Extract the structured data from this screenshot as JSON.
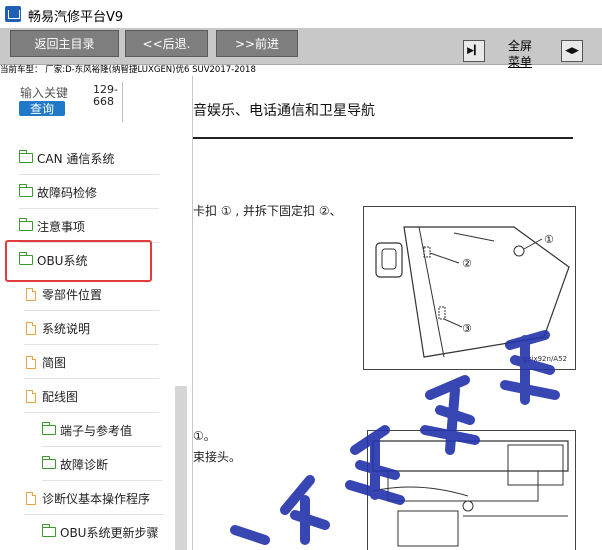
{
  "window": {
    "title": "畅易汽修平台V9"
  },
  "toolbar": {
    "home_label": "返回主目录",
    "back_label": "<<后退.",
    "forward_label": ">>前进",
    "fullscreen_top": "全屏",
    "fullscreen_bottom": "菜单"
  },
  "vehicle": {
    "text": "当前车型： 厂家:D-东风裕隆(纳智捷LUXGEN)优6 SUV2017-2018"
  },
  "search": {
    "label": "输入关键",
    "button_label": "查询",
    "range_top": "129-",
    "range_bottom": "668"
  },
  "tree": {
    "items": [
      {
        "label": "CAN 通信系统",
        "type": "folder"
      },
      {
        "label": "故障码检修",
        "type": "folder"
      },
      {
        "label": "注意事项",
        "type": "folder"
      },
      {
        "label": "OBU系统",
        "type": "folder",
        "selected": true
      },
      {
        "label": "零部件位置",
        "type": "doc"
      },
      {
        "label": "系统说明",
        "type": "doc"
      },
      {
        "label": "简图",
        "type": "doc"
      },
      {
        "label": "配线图",
        "type": "doc"
      },
      {
        "label": "端子与参考值",
        "type": "folder"
      },
      {
        "label": "故障诊断",
        "type": "folder"
      },
      {
        "label": "诊断仪基本操作程序",
        "type": "doc"
      },
      {
        "label": "OBU系统更新步骤",
        "type": "folder"
      }
    ]
  },
  "content": {
    "section_title": "音娱乐、电话通信和卫星导航",
    "para1": "卡扣 ① , 并拆下固定扣 ②、",
    "para2a": "①。",
    "para2b": "束接头。",
    "fig1": {
      "code": "gpix92n/A52",
      "callouts": [
        "①",
        "②",
        "③"
      ]
    }
  },
  "colors": {
    "toolbar_bg": "#c8c8c8",
    "button_bg": "#7e7e7e",
    "query_bg": "#1f78c8",
    "highlight": "#e23b3b",
    "folder": "#3a9b2c",
    "doc": "#e7a646",
    "watermark": "#2233aa"
  }
}
